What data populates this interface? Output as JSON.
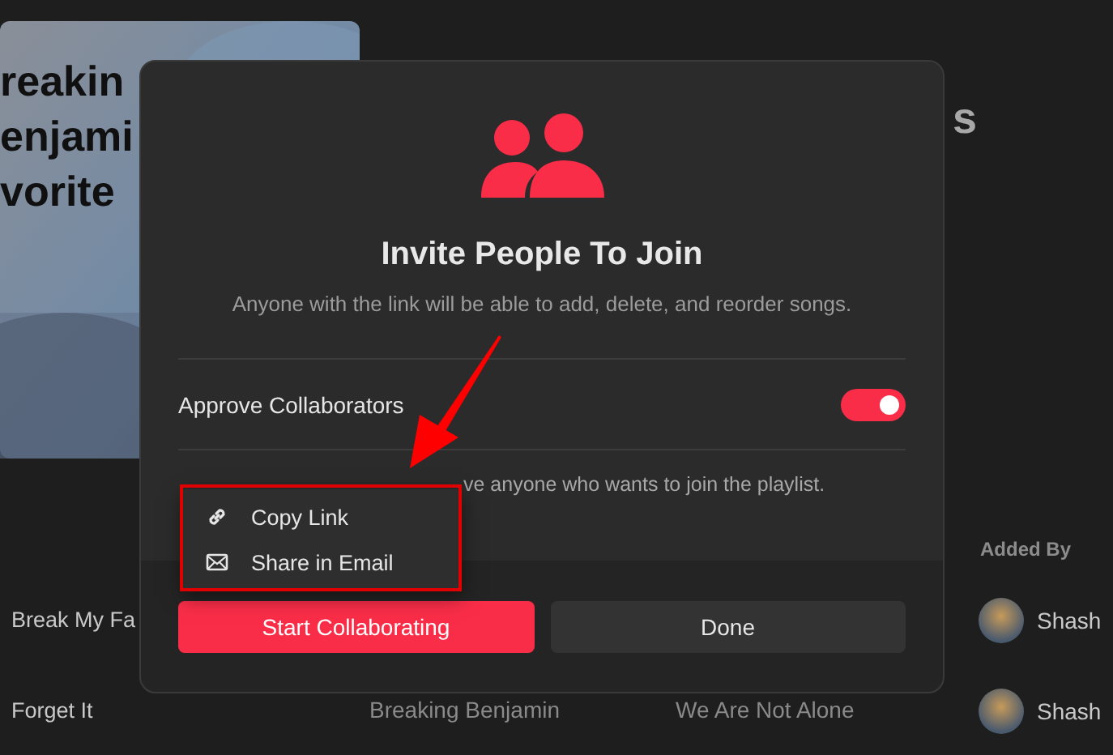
{
  "background": {
    "artwork": {
      "kind": "picture",
      "title_lines": [
        "reakin",
        "enjami",
        "vorite"
      ]
    },
    "playlist_title": "s",
    "columns": [
      {
        "label": "Added By"
      }
    ],
    "rows": [
      {
        "title": "Break My Fa",
        "added_by": "Shash"
      },
      {
        "title": "Forget It",
        "artist": "Breaking Benjamin",
        "album": "We Are Not Alone",
        "added_by": "Shash"
      }
    ]
  },
  "dialog": {
    "title": "Invite People To Join",
    "subtitle": "Anyone with the link will be able to add, delete, and reorder songs.",
    "setting": {
      "label": "Approve Collaborators",
      "on": true
    },
    "description": "ve anyone who wants to join the playlist.",
    "menu": {
      "items": [
        {
          "label": "Copy Link"
        },
        {
          "label": "Share in Email"
        }
      ]
    },
    "buttons": [
      {
        "label": "Start Collaborating",
        "kind": "primary"
      },
      {
        "label": "Done",
        "kind": "secondary"
      }
    ]
  },
  "annotations": {
    "arrow": true,
    "highlight_frame": true
  }
}
